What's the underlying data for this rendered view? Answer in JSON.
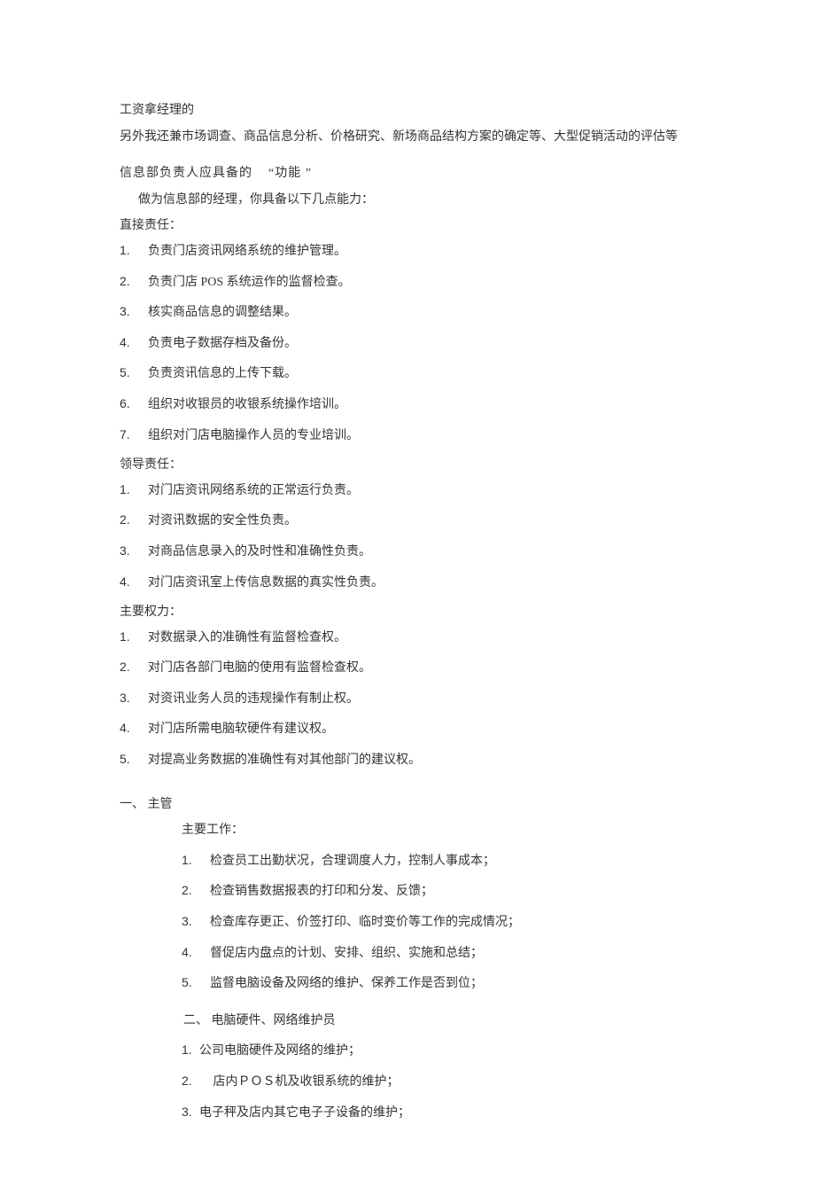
{
  "intro": {
    "line1": "工资拿经理的",
    "line2": "另外我还兼市场调查、商品信息分析、价格研究、新场商品结构方案的确定等、大型促销活动的评估等"
  },
  "section1": {
    "title_prefix": "信息部负责人应具备的",
    "title_quote_open": "“",
    "title_word": "功能",
    "title_quote_close": "”",
    "intro": "做为信息部的经理，你具备以下几点能力：",
    "direct_label": "直接责任：",
    "direct_items": [
      "负责门店资讯网络系统的维护管理。",
      "负责门店  POS 系统运作的监督检查。",
      "核实商品信息的调整结果。",
      "负责电子数据存档及备份。",
      "负责资讯信息的上传下载。",
      "组织对收银员的收银系统操作培训。",
      "组织对门店电脑操作人员的专业培训。"
    ],
    "lead_label": "领导责任：",
    "lead_items": [
      "对门店资讯网络系统的正常运行负责。",
      "对资讯数据的安全性负责。",
      "对商品信息录入的及时性和准确性负责。",
      "对门店资讯室上传信息数据的真实性负责。"
    ],
    "power_label": "主要权力：",
    "power_items": [
      "对数据录入的准确性有监督检查权。",
      "对门店各部门电脑的使用有监督检查权。",
      "对资讯业务人员的违规操作有制止权。",
      "对门店所需电脑软硬件有建议权。",
      "对提高业务数据的准确性有对其他部门的建议权。"
    ]
  },
  "section2": {
    "roman_label": "一、  主管",
    "work_label": "主要工作：",
    "work_items": [
      "检查员工出勤状况，合理调度人力，控制人事成本；",
      "检查销售数据报表的打印和分发、反馈；",
      "检查库存更正、价签打印、临时变价等工作的完成情况；",
      "督促店内盘点的计划、安排、组织、实施和总结；",
      "监督电脑设备及网络的维护、保养工作是否到位；"
    ]
  },
  "section3": {
    "roman_label": "二、  电脑硬件、网络维护员",
    "items": [
      "公司电脑硬件及网络的维护；",
      " 店内ＰＯＳ机及收银系统的维护；",
      "电子秤及店内其它电子子设备的维护；"
    ]
  },
  "nums": [
    "1.",
    "2.",
    "3.",
    "4.",
    "5.",
    "6.",
    "7."
  ]
}
